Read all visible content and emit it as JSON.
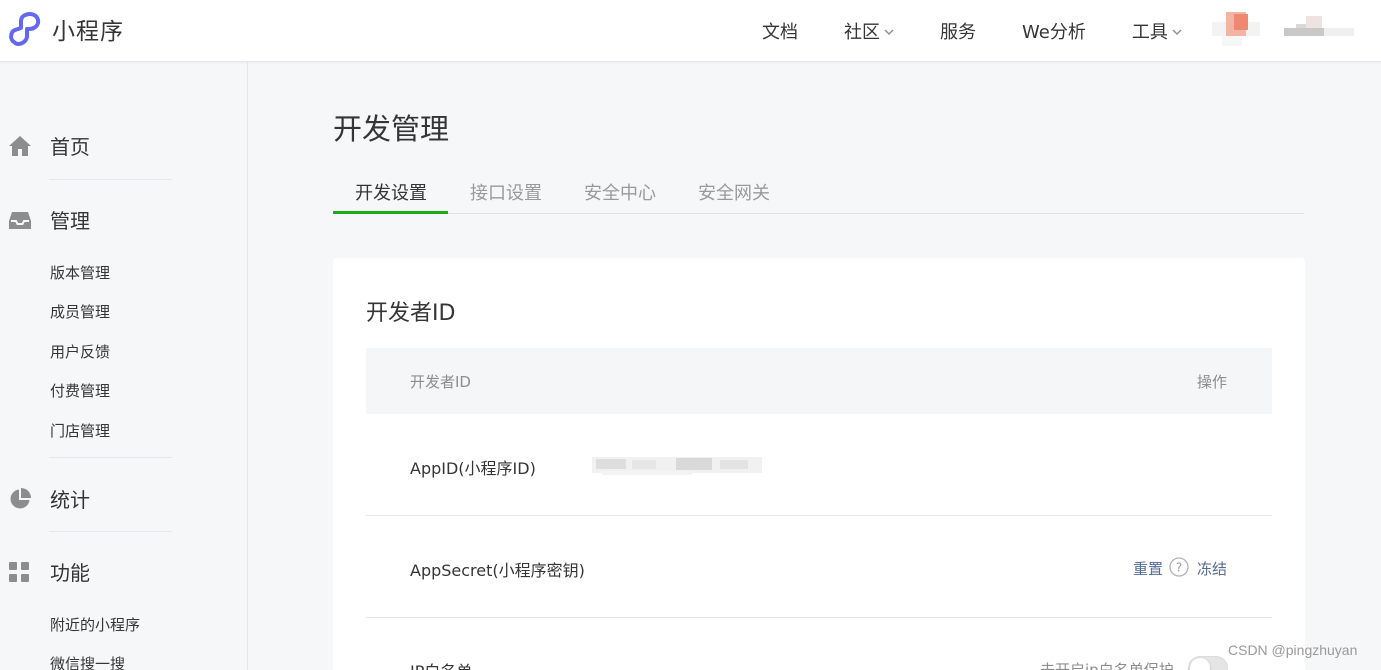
{
  "brand": {
    "title": "小程序",
    "logo_icon": "miniprogram-logo-icon",
    "logo_color": "#6467f0"
  },
  "topnav": {
    "items": [
      {
        "label": "文档",
        "has_dropdown": false
      },
      {
        "label": "社区",
        "has_dropdown": true
      },
      {
        "label": "服务",
        "has_dropdown": false
      },
      {
        "label": "We分析",
        "has_dropdown": false
      },
      {
        "label": "工具",
        "has_dropdown": true
      }
    ],
    "avatar_icon": "user-avatar"
  },
  "sidebar": {
    "home": {
      "label": "首页",
      "icon": "home-icon"
    },
    "manage": {
      "label": "管理",
      "icon": "inbox-icon",
      "items": [
        "版本管理",
        "成员管理",
        "用户反馈",
        "付费管理",
        "门店管理"
      ]
    },
    "stats": {
      "label": "统计",
      "icon": "pie-chart-icon"
    },
    "features": {
      "label": "功能",
      "icon": "grid-icon",
      "items": [
        "附近的小程序",
        "微信搜一搜"
      ]
    }
  },
  "main": {
    "title": "开发管理",
    "tabs": [
      "开发设置",
      "接口设置",
      "安全中心",
      "安全网关"
    ],
    "active_tab": 0,
    "card": {
      "title": "开发者ID",
      "columns": [
        "开发者ID",
        "操作"
      ],
      "rows": [
        {
          "label": "AppID(小程序ID)"
        },
        {
          "label": "AppSecret(小程序密钥)",
          "actions": [
            "重置",
            "冻结"
          ]
        },
        {
          "label": "IP白名单",
          "status": "未开启ip白名单保护",
          "toggle_on": false
        }
      ]
    }
  },
  "watermark": "CSDN @pingzhuyan",
  "colors": {
    "accent_green": "#1aad19",
    "link_blue": "#576b95"
  }
}
